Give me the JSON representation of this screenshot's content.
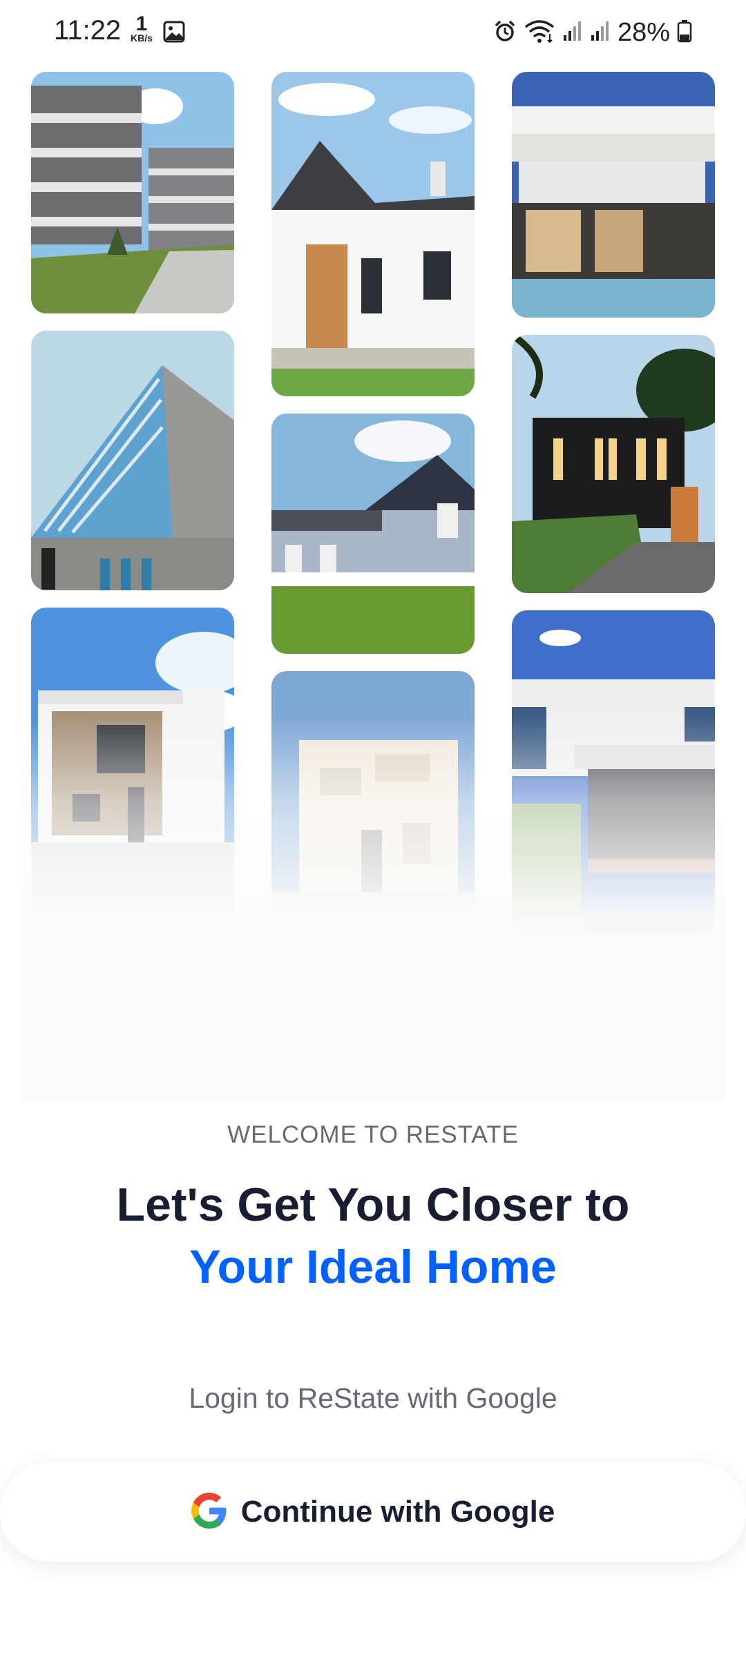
{
  "status_bar": {
    "time": "11:22",
    "network_speed_value": "1",
    "network_speed_unit": "KB/s",
    "battery_percent": "28%"
  },
  "gallery": {
    "images": [
      {
        "name": "apartment-complex-image",
        "column": 1,
        "row": 1
      },
      {
        "name": "gabled-house-image",
        "column": 2,
        "row": 1
      },
      {
        "name": "modern-pool-villa-image",
        "column": 3,
        "row": 1
      },
      {
        "name": "angular-facade-building-image",
        "column": 1,
        "row": 2
      },
      {
        "name": "clapboard-family-house-image",
        "column": 2,
        "row": 2
      },
      {
        "name": "dark-modern-house-image",
        "column": 3,
        "row": 2
      },
      {
        "name": "white-cube-house-image",
        "column": 1,
        "row": 3
      },
      {
        "name": "beige-townhouse-image",
        "column": 2,
        "row": 3
      },
      {
        "name": "white-house-patio-image",
        "column": 3,
        "row": 3
      }
    ]
  },
  "welcome_label": "WELCOME TO RESTATE",
  "headline": {
    "line1": "Let's Get You Closer to",
    "line2": "Your Ideal Home"
  },
  "login_prompt": "Login to ReState with Google",
  "google_button": {
    "label": "Continue with Google",
    "icon": "google-logo-icon"
  },
  "colors": {
    "primary": "#0061ff",
    "heading": "#191d31",
    "muted": "#666876"
  }
}
